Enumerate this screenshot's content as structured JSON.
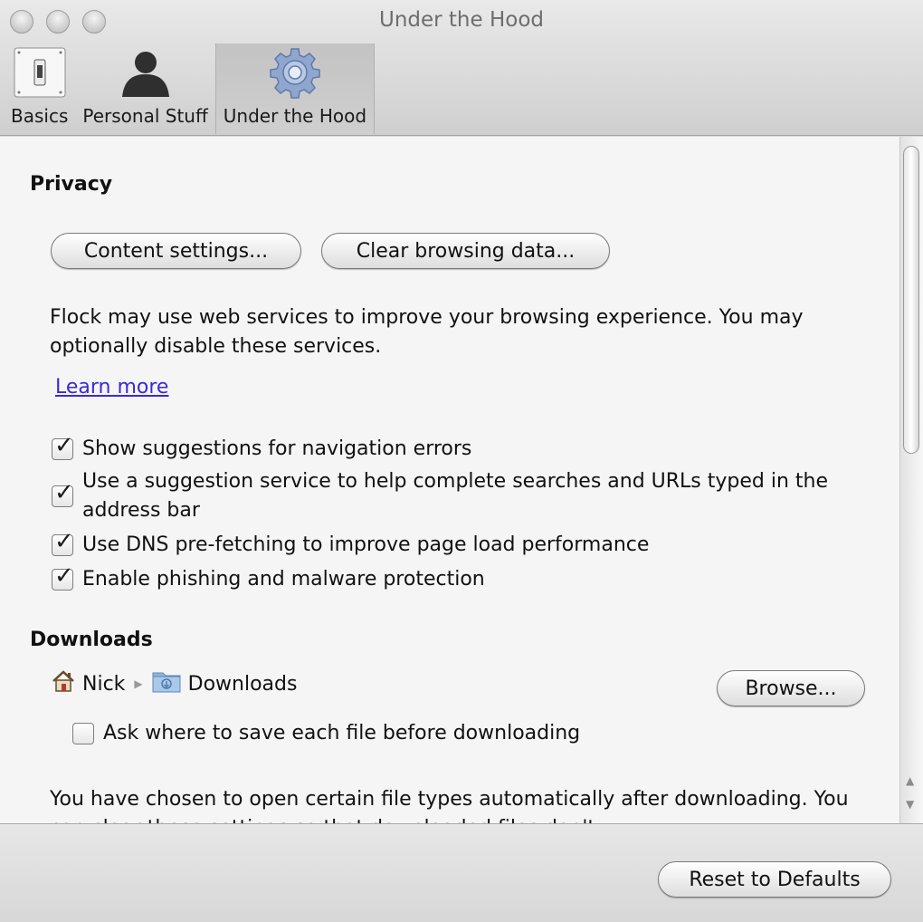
{
  "window": {
    "title": "Under the Hood"
  },
  "toolbar": {
    "items": [
      {
        "label": "Basics",
        "icon": "switch-icon"
      },
      {
        "label": "Personal Stuff",
        "icon": "person-icon"
      },
      {
        "label": "Under the Hood",
        "icon": "gear-icon",
        "selected": true
      }
    ]
  },
  "privacy": {
    "heading": "Privacy",
    "content_settings_label": "Content settings...",
    "clear_browsing_label": "Clear browsing data...",
    "description": "Flock may use web services to improve your browsing experience. You may optionally disable these services.",
    "learn_more": "Learn more",
    "options": [
      {
        "label": "Show suggestions for navigation errors",
        "checked": true
      },
      {
        "label": "Use a suggestion service to help complete searches and URLs typed in the address bar",
        "checked": true
      },
      {
        "label": "Use DNS pre-fetching to improve page load performance",
        "checked": true
      },
      {
        "label": "Enable phishing and malware protection",
        "checked": true
      }
    ]
  },
  "downloads": {
    "heading": "Downloads",
    "path": {
      "home": "Nick",
      "folder": "Downloads"
    },
    "browse_label": "Browse...",
    "ask_label": "Ask where to save each file before downloading",
    "ask_checked": false,
    "auto_open_text": "You have chosen to open certain file types automatically after downloading. You can clear these settings so that downloaded files don't"
  },
  "footer": {
    "reset_label": "Reset to Defaults"
  }
}
